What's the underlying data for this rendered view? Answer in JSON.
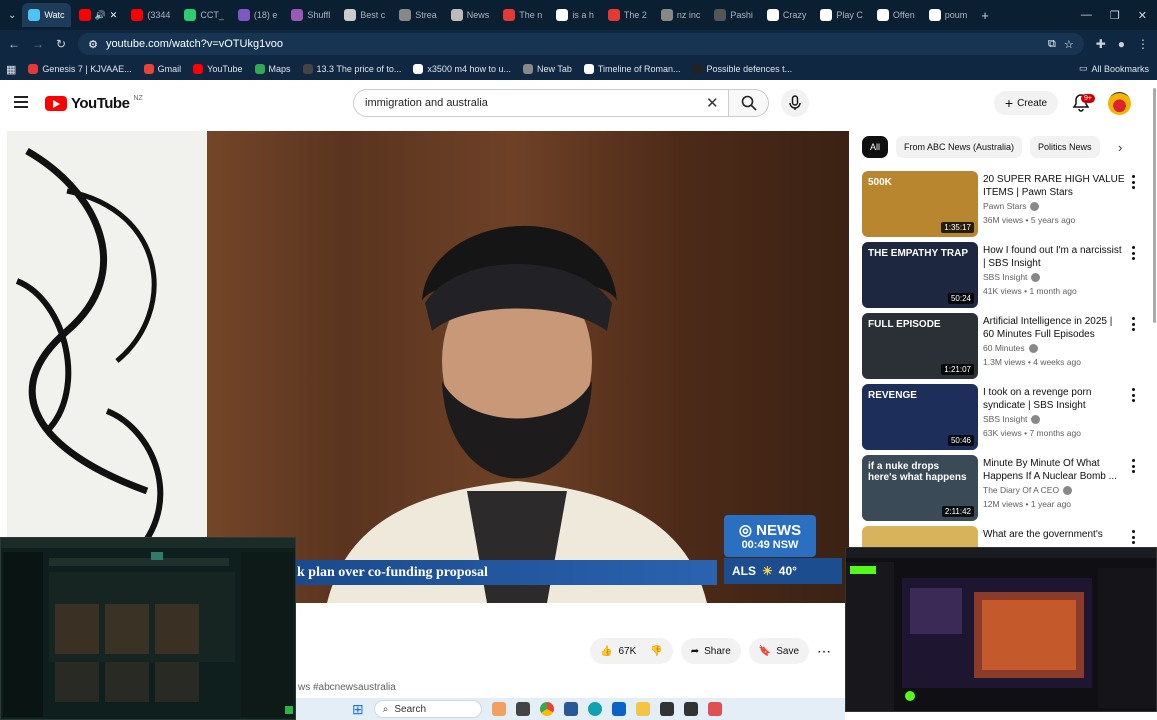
{
  "browser": {
    "tabs": [
      {
        "label": "Watc",
        "color": "#4fc3f7",
        "active": true
      },
      {
        "label": "CCT_",
        "color": "#2ecc71",
        "active": false
      },
      {
        "label": "(18) e",
        "color": "#7e57c2",
        "active": false
      },
      {
        "label": "Shuffl",
        "color": "#9b59b6",
        "active": false
      },
      {
        "label": "Best c",
        "color": "#cccccc",
        "active": false
      },
      {
        "label": "Strea",
        "color": "#888888",
        "active": false
      },
      {
        "label": "News",
        "color": "#bbbbbb",
        "active": false
      },
      {
        "label": "The n",
        "color": "#e53935",
        "active": false
      },
      {
        "label": "is a h",
        "color": "#ffffff",
        "active": false
      },
      {
        "label": "The 2",
        "color": "#e53935",
        "active": false
      },
      {
        "label": "nz inc",
        "color": "#888888",
        "active": false
      },
      {
        "label": "Pashi",
        "color": "#555555",
        "active": false
      },
      {
        "label": "Crazy",
        "color": "#ffffff",
        "active": false
      },
      {
        "label": "Play C",
        "color": "#ffffff",
        "active": false
      },
      {
        "label": "Offen",
        "color": "#ffffff",
        "active": false
      },
      {
        "label": "poum",
        "color": "#ffffff",
        "active": false
      }
    ],
    "second_tab_label": "(3344",
    "url": "youtube.com/watch?v=vOTUkg1voo",
    "bookmarks": [
      {
        "label": "Genesis 7 | KJVAAE...",
        "color": "#e53935"
      },
      {
        "label": "Gmail",
        "color": "#ea4335"
      },
      {
        "label": "YouTube",
        "color": "#ff0000"
      },
      {
        "label": "Maps",
        "color": "#34a853"
      },
      {
        "label": "13.3 The price of to...",
        "color": "#444444"
      },
      {
        "label": "x3500 m4 how to u...",
        "color": "#ffffff"
      },
      {
        "label": "New Tab",
        "color": "#888888"
      },
      {
        "label": "Timeline of Roman...",
        "color": "#ffffff"
      },
      {
        "label": "Possible defences t...",
        "color": "#222222"
      }
    ],
    "all_bookmarks": "All Bookmarks"
  },
  "youtube": {
    "logo_text": "YouTube",
    "logo_country": "NZ",
    "search_value": "immigration and australia",
    "create_label": "Create",
    "notif_count": "9+"
  },
  "video": {
    "lower_third": "k plan over co-funding proposal",
    "abc_brand": "NEWS",
    "abc_time": "00:49",
    "abc_state": "NSW",
    "abc_location": "ALS",
    "abc_temp": "40°",
    "likes": "67K",
    "share_label": "Share",
    "save_label": "Save",
    "hashtags": "ws #abcnewsaustralia"
  },
  "sidebar": {
    "chips": [
      {
        "label": "All",
        "active": true
      },
      {
        "label": "From ABC News (Australia)",
        "active": false
      },
      {
        "label": "Politics News",
        "active": false
      }
    ],
    "items": [
      {
        "title": "20 SUPER RARE HIGH VALUE ITEMS | Pawn Stars",
        "channel": "Pawn Stars",
        "meta": "36M views • 5 years ago",
        "duration": "1:35:17",
        "thumb_text": "500K",
        "thumb_bg": "#b8862f"
      },
      {
        "title": "How I found out I'm a narcissist | SBS Insight",
        "channel": "SBS Insight",
        "meta": "41K views • 1 month ago",
        "duration": "50:24",
        "thumb_text": "THE EMPATHY TRAP",
        "thumb_bg": "#1d2740"
      },
      {
        "title": "Artificial Intelligence in 2025 | 60 Minutes Full Episodes",
        "channel": "60 Minutes",
        "meta": "1.3M views • 4 weeks ago",
        "duration": "1:21:07",
        "thumb_text": "FULL EPISODE",
        "thumb_bg": "#2b3036"
      },
      {
        "title": "I took on a revenge porn syndicate | SBS Insight",
        "channel": "SBS Insight",
        "meta": "63K views • 7 months ago",
        "duration": "50:46",
        "thumb_text": "REVENGE",
        "thumb_bg": "#1d2e5a"
      },
      {
        "title": "Minute By Minute Of What Happens If A Nuclear Bomb ...",
        "channel": "The Diary Of A CEO",
        "meta": "12M views • 1 year ago",
        "duration": "2:11:42",
        "thumb_text": "if a nuke drops here's what happens",
        "thumb_bg": "#3b4a57"
      },
      {
        "title": "What are the government's",
        "channel": "",
        "meta": "",
        "duration": "",
        "thumb_text": "",
        "thumb_bg": "#d8b35c"
      }
    ]
  },
  "taskbar": {
    "search_label": "Search"
  }
}
